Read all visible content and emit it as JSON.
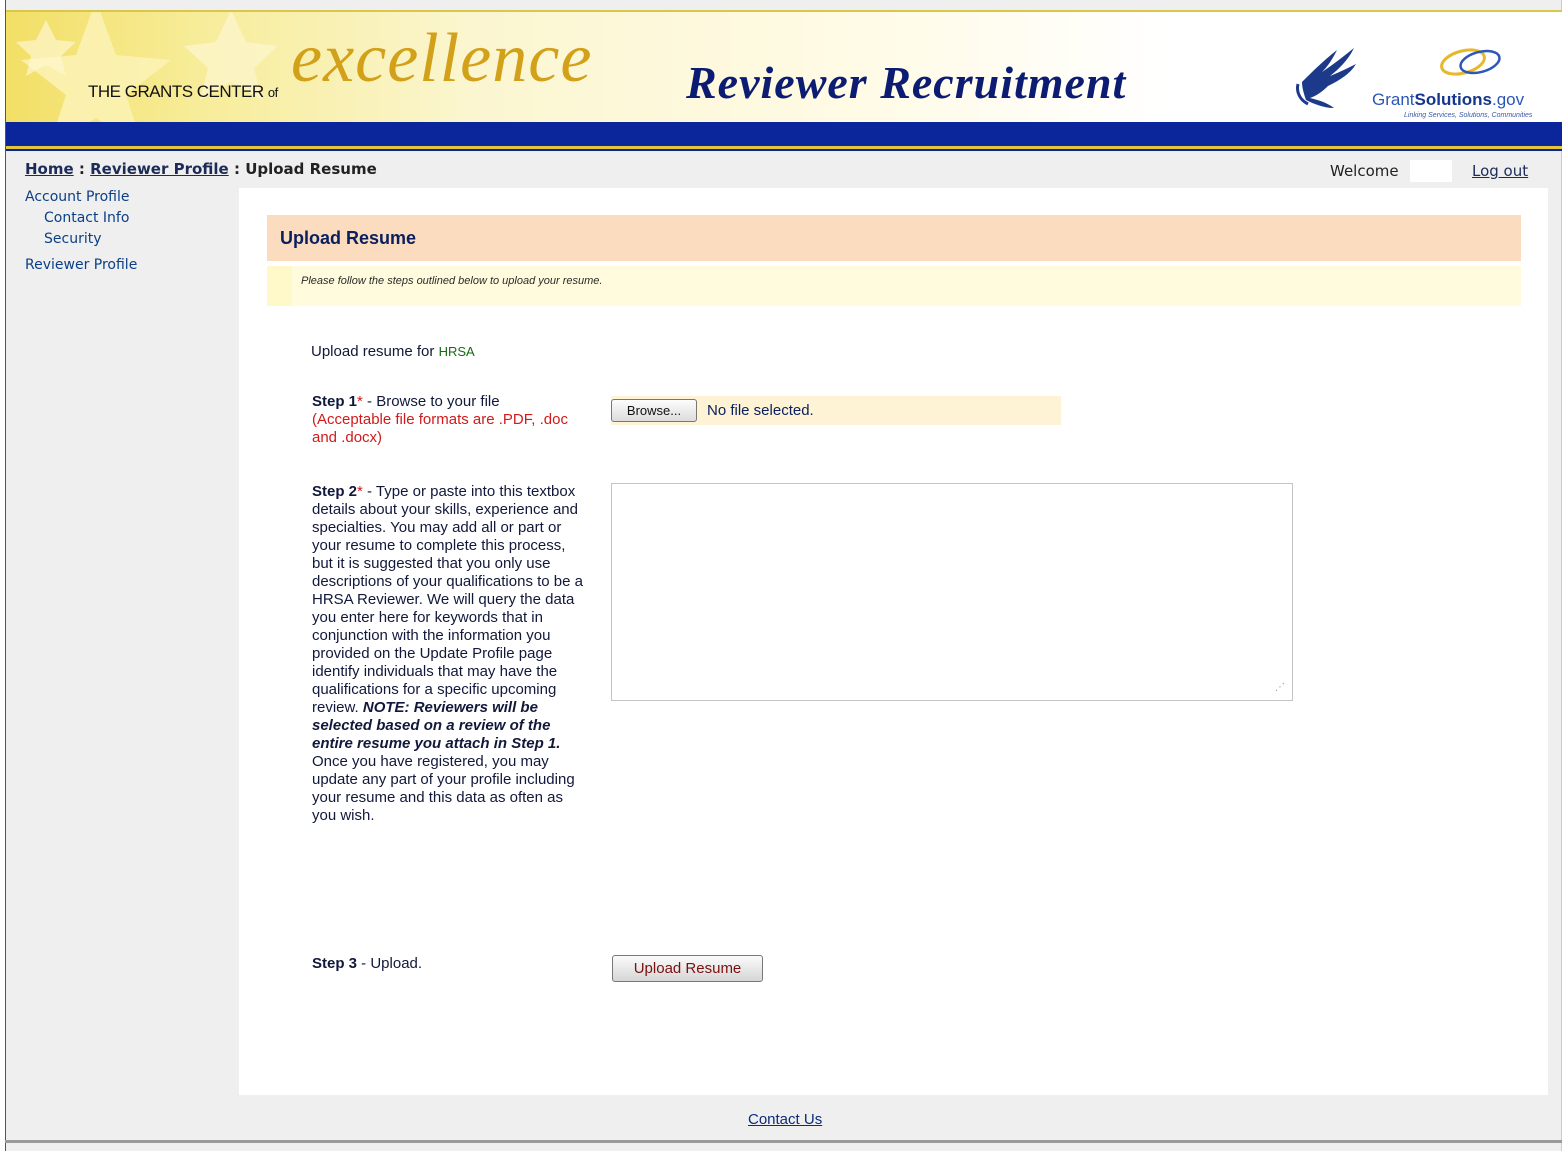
{
  "banner": {
    "grants_text": "THE GRANTS CENTER",
    "of_text": "of",
    "excellence": "excellence",
    "recruitment": "Reviewer Recruitment",
    "gs_prefix": "Grant",
    "gs_bold": "Solutions",
    "gs_suffix": ".gov",
    "gs_tagline": "Linking Services, Solutions, Communities"
  },
  "breadcrumb": {
    "home": "Home",
    "sep1": " : ",
    "reviewer_profile": "Reviewer Profile",
    "sep2": " : ",
    "current": "Upload Resume"
  },
  "header": {
    "welcome": "Welcome",
    "logout": "Log out"
  },
  "sidebar": {
    "items": [
      {
        "label": "Account Profile"
      },
      {
        "label": "Contact Info"
      },
      {
        "label": "Security"
      },
      {
        "label": "Reviewer Profile"
      }
    ]
  },
  "main": {
    "title": "Upload Resume",
    "instructions": "Please follow the steps outlined below to upload your resume.",
    "upload_for_label": "Upload resume for ",
    "agency": "HRSA",
    "step1": {
      "label": "Step 1",
      "required_mark": "*",
      "text": "  - Browse to your file",
      "formats": "(Acceptable file formats are .PDF, .doc and .docx)",
      "browse_button": "Browse...",
      "file_status": "No file selected."
    },
    "step2": {
      "label": "Step 2",
      "required_mark": "*",
      "text": " - Type or paste into this textbox details about your skills, experience and specialties. You may add all or part or your resume to complete this process, but it is suggested that you only use descriptions of your qualifications to be a HRSA Reviewer. We will query the data you enter here for keywords that in conjunction with the information you provided on the Update Profile page identify individuals that may have the qualifications for a specific upcoming review. ",
      "note": "NOTE: Reviewers will be selected based on a review of the entire resume you attach in Step 1.",
      "after_note": " Once you have registered, you may update any part of your profile including your resume and this data as often as you wish.",
      "textarea_value": ""
    },
    "step3": {
      "label": "Step 3",
      "text": " - Upload.",
      "button": "Upload Resume"
    }
  },
  "footer": {
    "contact": "Contact Us"
  },
  "icons": {
    "hhs_logo": "hhs-eagle-icon",
    "grant_solutions_logo": "grantsolutions-rings-icon",
    "banner_stars": "star-icon",
    "textarea_resize": "resize-grip-icon"
  },
  "colors": {
    "nav_blue": "#0b259a",
    "excellence_gold": "#d3a019",
    "recruitment_navy": "#0c1c72",
    "section_header": "#fcdcbf",
    "instructions_bg": "#fffbdc",
    "required_red": "#d21a1a",
    "agency_green": "#166a0e"
  }
}
